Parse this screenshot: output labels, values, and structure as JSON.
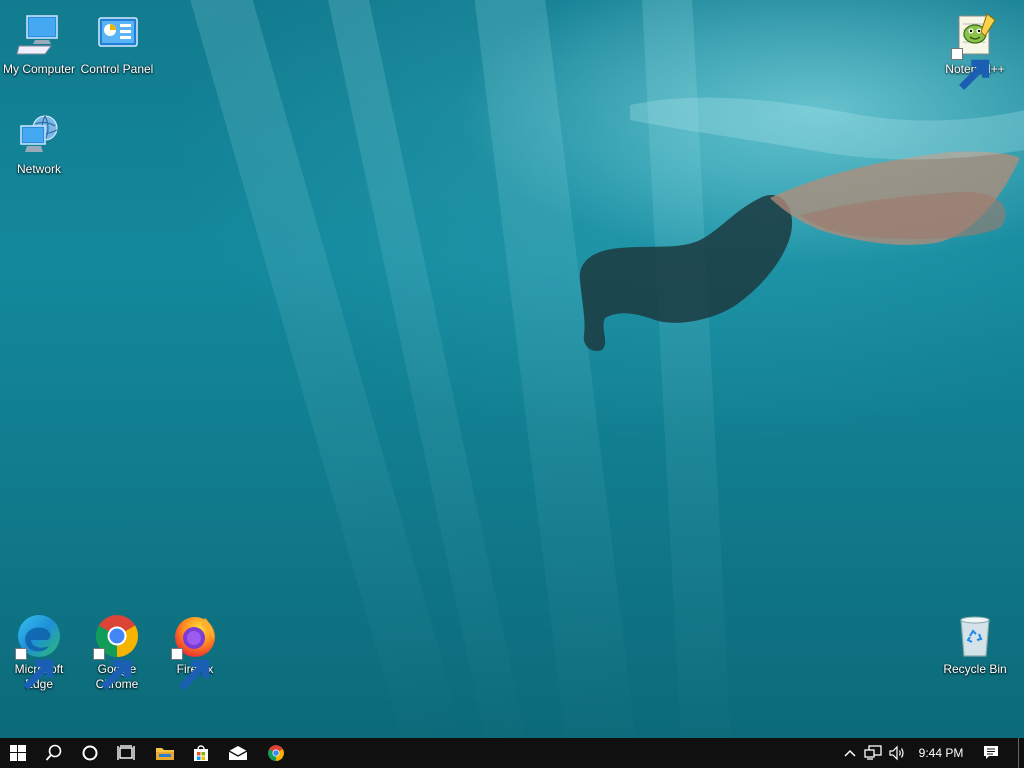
{
  "desktop": {
    "icons": {
      "my_computer": {
        "label": "My Computer",
        "icon": "computer-icon"
      },
      "control_panel": {
        "label": "Control Panel",
        "icon": "control-panel-icon"
      },
      "network": {
        "label": "Network",
        "icon": "network-icon"
      },
      "notepadpp": {
        "label": "Notepad++",
        "icon": "notepadpp-icon"
      },
      "edge": {
        "label": "Microsoft Edge",
        "icon": "edge-icon"
      },
      "chrome": {
        "label": "Google Chrome",
        "icon": "chrome-icon"
      },
      "firefox": {
        "label": "Firefox",
        "icon": "firefox-icon"
      },
      "recycle_bin": {
        "label": "Recycle Bin",
        "icon": "recycle-bin-icon"
      }
    }
  },
  "taskbar": {
    "buttons": [
      "start-icon",
      "search-icon",
      "cortana-icon",
      "task-view-icon",
      "file-explorer-icon",
      "store-icon",
      "mail-icon",
      "chrome-icon"
    ],
    "tray": {
      "clock": "9:44 PM",
      "icons": [
        "chevron-up-icon",
        "network-icon",
        "volume-icon",
        "notification-icon"
      ]
    }
  },
  "colors": {
    "taskbar": "#101010",
    "water": "#13889c"
  }
}
